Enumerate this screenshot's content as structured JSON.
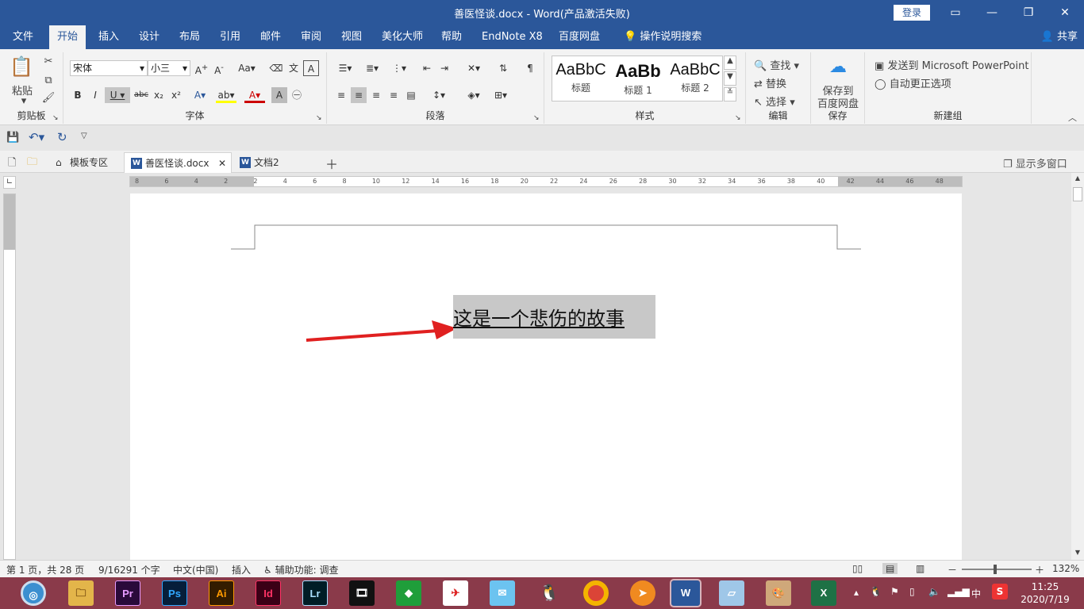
{
  "window": {
    "title": "善医怪谈.docx  -  Word(产品激活失败)",
    "login_label": "登录"
  },
  "ribbon_tabs": [
    "文件",
    "开始",
    "插入",
    "设计",
    "布局",
    "引用",
    "邮件",
    "审阅",
    "视图",
    "美化大师",
    "帮助",
    "EndNote X8",
    "百度网盘",
    "操作说明搜索"
  ],
  "share_label": "共享",
  "clipboard": {
    "paste_label": "粘贴",
    "group_label": "剪贴板"
  },
  "font": {
    "name": "宋体",
    "size": "小三",
    "group_label": "字体"
  },
  "paragraph": {
    "group_label": "段落"
  },
  "styles": {
    "group_label": "样式",
    "items": [
      {
        "sample": "AaBbC",
        "name": "标题"
      },
      {
        "sample": "AaBb",
        "name": "标题 1"
      },
      {
        "sample": "AaBbC",
        "name": "标题 2"
      }
    ]
  },
  "editing": {
    "find": "查找",
    "replace": "替换",
    "select": "选择",
    "group_label": "编辑"
  },
  "save_group": {
    "save_to_baidu_line1": "保存到",
    "save_to_baidu_line2": "百度网盘",
    "group_label": "保存"
  },
  "new_group": {
    "send_ppt": "发送到 Microsoft PowerPoint",
    "autocorrect": "自动更正选项",
    "group_label": "新建组"
  },
  "doc_tabs": [
    {
      "label": "模板专区"
    },
    {
      "label": "善医怪谈.docx"
    },
    {
      "label": "文档2"
    }
  ],
  "multi_window_label": "显示多窗口",
  "ruler_ticks": [
    "8",
    "6",
    "4",
    "2",
    "2",
    "4",
    "6",
    "8",
    "10",
    "12",
    "14",
    "16",
    "18",
    "20",
    "22",
    "24",
    "26",
    "28",
    "30",
    "32",
    "34",
    "36",
    "38",
    "40",
    "42",
    "44",
    "46",
    "48"
  ],
  "document": {
    "selected_text": "这是一个悲伤的故事"
  },
  "status": {
    "page": "第 1 页，共 28 页",
    "words": "9/16291 个字",
    "language": "中文(中国)",
    "mode": "插入",
    "accessibility": "辅助功能: 调查",
    "zoom": "132%"
  },
  "taskbar": {
    "apps": [
      "Pr",
      "Ps",
      "Ai",
      "Id",
      "Lr"
    ],
    "ime": "中",
    "time": "11:25",
    "date": "2020/7/19"
  }
}
